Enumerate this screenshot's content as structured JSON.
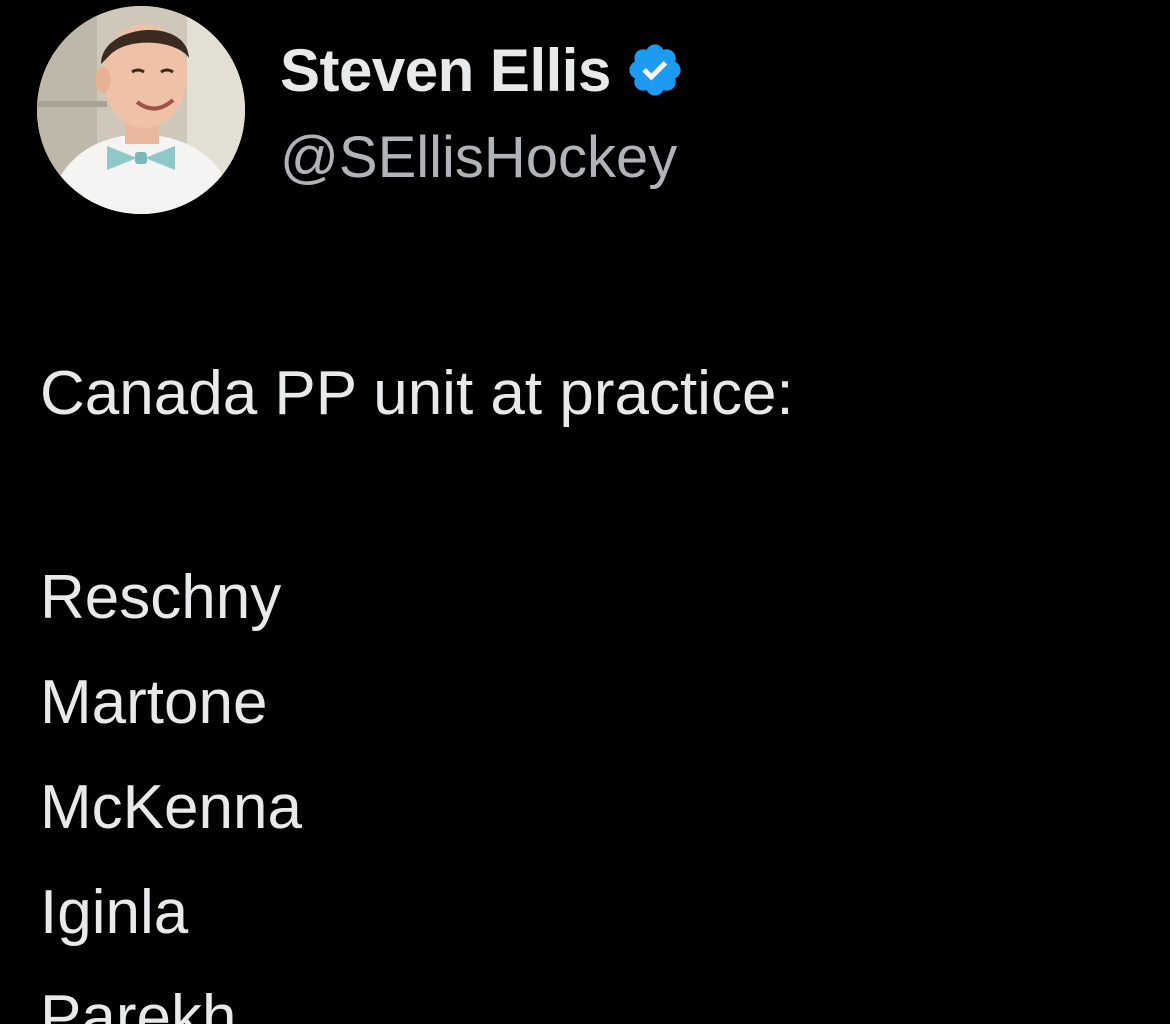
{
  "author": {
    "display_name": "Steven Ellis",
    "handle": "@SEllisHockey",
    "verified_icon": "verified-badge-icon",
    "verified_color": "#1d9bf0"
  },
  "tweet": {
    "intro": "Canada PP unit at practice:",
    "players": [
      "Reschny",
      "Martone",
      "McKenna",
      "Iginla",
      "Parekh"
    ]
  },
  "colors": {
    "background": "#000000",
    "text": "#e7e9ea",
    "handle": "#b0b3b8"
  }
}
